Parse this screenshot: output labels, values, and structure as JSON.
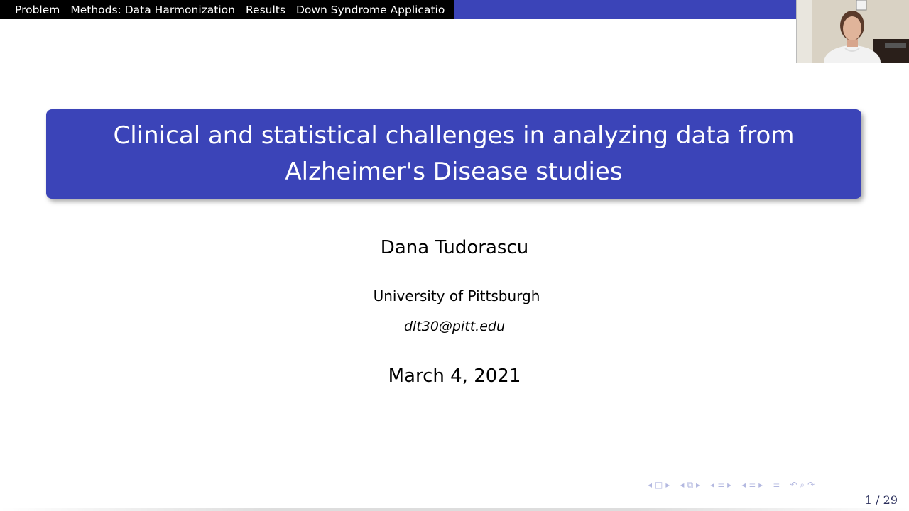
{
  "nav": {
    "items": [
      "Problem",
      "Methods: Data Harmonization",
      "Results",
      "Down Syndrome Applicatio"
    ]
  },
  "slide": {
    "title_line1": "Clinical and statistical challenges in analyzing data from",
    "title_line2": "Alzheimer's Disease studies",
    "author": "Dana Tudorascu",
    "institute": "University of Pittsburgh",
    "email": "dlt30@pitt.edu",
    "date": "March 4, 2021"
  },
  "footer": {
    "page": "1 / 29"
  },
  "colors": {
    "accent": "#3b44b8",
    "nav_dark": "#000000",
    "nav_symbols": "#b3b8e0"
  }
}
